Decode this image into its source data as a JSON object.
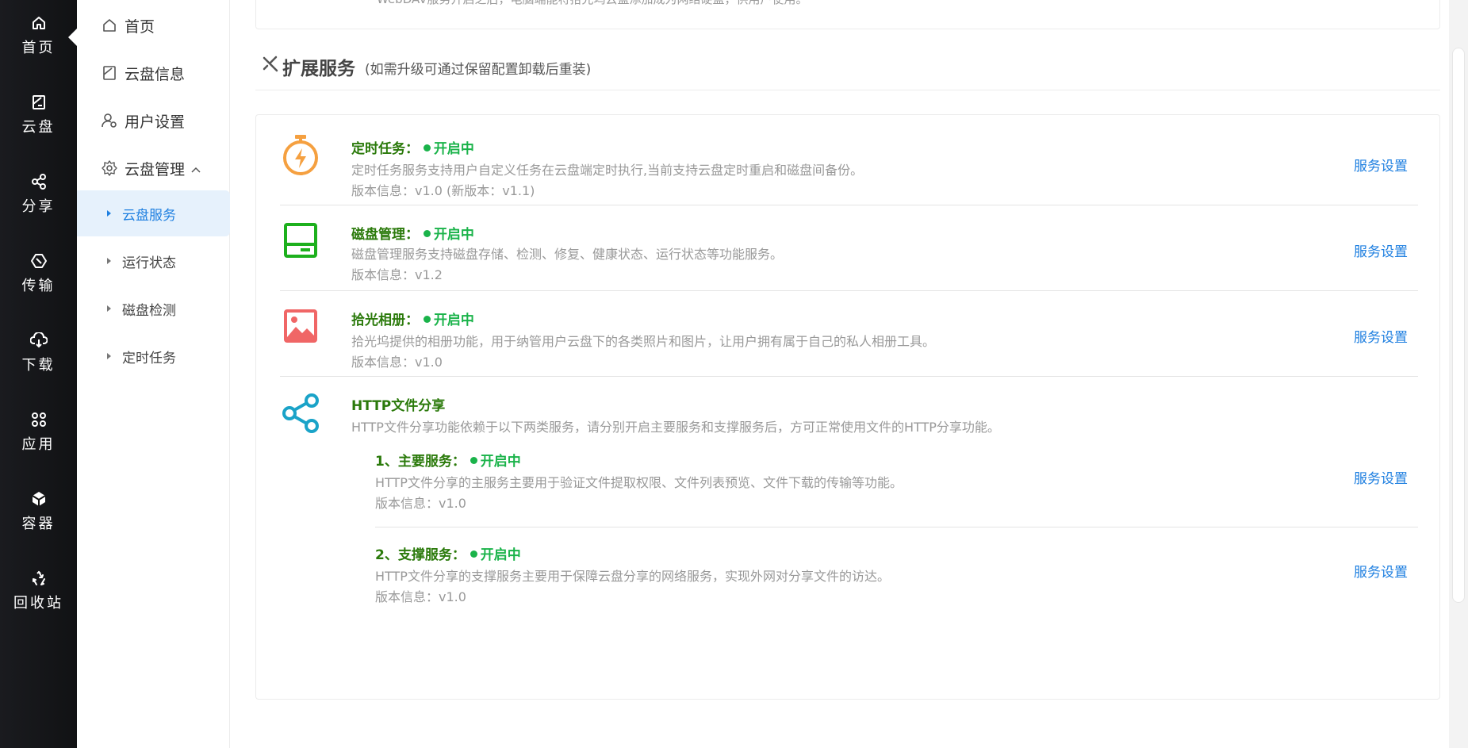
{
  "rail": {
    "items": [
      {
        "label": "首页",
        "icon": "home-icon"
      },
      {
        "label": "云盘",
        "icon": "disk-icon"
      },
      {
        "label": "分享",
        "icon": "share-icon"
      },
      {
        "label": "传输",
        "icon": "transfer-icon"
      },
      {
        "label": "下载",
        "icon": "download-cloud-icon"
      },
      {
        "label": "应用",
        "icon": "apps-icon"
      },
      {
        "label": "容器",
        "icon": "container-icon"
      },
      {
        "label": "回收站",
        "icon": "recycle-icon"
      }
    ],
    "active_index": 0
  },
  "subnav": {
    "home": "首页",
    "disk_info": "云盘信息",
    "user_settings": "用户设置",
    "disk_manage": "云盘管理",
    "children": [
      "云盘服务",
      "运行状态",
      "磁盘检测",
      "定时任务"
    ],
    "active_child": 0
  },
  "top_card": {
    "text": "WebDAV服务开启之后，电脑端能将拾光坞云盘添加成为网络硬盘，供用户使用。"
  },
  "section": {
    "title": "扩展服务",
    "note": "(如需升级可通过保留配置卸载后重装)"
  },
  "services": [
    {
      "name": "定时任务：",
      "status": "开启中",
      "desc": "定时任务服务支持用户自定义任务在云盘端定时执行,当前支持云盘定时重启和磁盘间备份。",
      "version": "版本信息：v1.0 (新版本：v1.1)",
      "link": "服务设置",
      "icon": "timer-icon",
      "color": "#f5a040"
    },
    {
      "name": "磁盘管理：",
      "status": "开启中",
      "desc": "磁盘管理服务支持磁盘存储、检测、修复、健康状态、运行状态等功能服务。",
      "version": "版本信息：v1.2",
      "link": "服务设置",
      "icon": "disk-manage-icon",
      "color": "#1db01d"
    },
    {
      "name": "拾光相册：",
      "status": "开启中",
      "desc": "拾光坞提供的相册功能，用于纳管用户云盘下的各类照片和图片，让用户拥有属于自己的私人相册工具。",
      "version": "版本信息：v1.0",
      "link": "服务设置",
      "icon": "photo-album-icon",
      "color": "#f06666"
    }
  ],
  "http_share": {
    "title": "HTTP文件分享",
    "desc": "HTTP文件分享功能依赖于以下两类服务，请分别开启主要服务和支撑服务后，方可正常使用文件的HTTP分享功能。",
    "icon": "share-nodes-icon",
    "color": "#1aa3c8",
    "subs": [
      {
        "name": "1、主要服务：",
        "status": "开启中",
        "desc": "HTTP文件分享的主服务主要用于验证文件提取权限、文件列表预览、文件下载的传输等功能。",
        "version": "版本信息：v1.0",
        "link": "服务设置"
      },
      {
        "name": "2、支撑服务：",
        "status": "开启中",
        "desc": "HTTP文件分享的支撑服务主要用于保障云盘分享的网络服务，实现外网对分享文件的访达。",
        "version": "版本信息：v1.0",
        "link": "服务设置"
      }
    ]
  }
}
